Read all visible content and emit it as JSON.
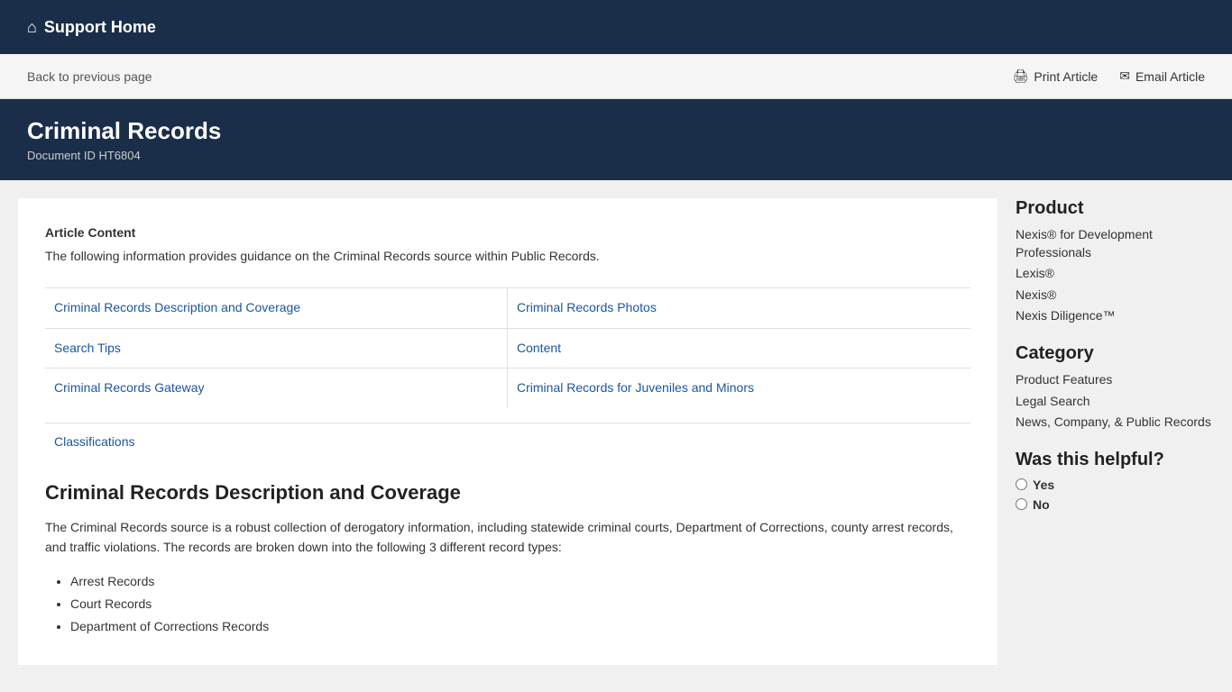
{
  "topNav": {
    "homeIcon": "⌂",
    "homeLabel": "Support Home",
    "homeUrl": "#"
  },
  "secondaryNav": {
    "backLabel": "Back to previous page",
    "printLabel": "Print Article",
    "emailLabel": "Email Article",
    "printIcon": "🖨",
    "emailIcon": "✉"
  },
  "articleHeader": {
    "title": "Criminal Records",
    "docId": "Document ID HT6804"
  },
  "articleContent": {
    "contentLabel": "Article Content",
    "intro": "The following information provides guidance on the Criminal Records source within Public Records.",
    "tocLinks": [
      {
        "text": "Criminal Records Description and Coverage",
        "href": "#desc"
      },
      {
        "text": "Criminal Records Photos",
        "href": "#photos"
      },
      {
        "text": "Search Tips",
        "href": "#search-tips"
      },
      {
        "text": "Content",
        "href": "#content"
      },
      {
        "text": "Criminal Records Gateway",
        "href": "#gateway"
      },
      {
        "text": "Criminal Records for Juveniles and Minors",
        "href": "#juveniles"
      }
    ],
    "classificationsLink": "Classifications",
    "sectionHeading": "Criminal Records Description and Coverage",
    "sectionBody": "The Criminal Records source is a robust collection of derogatory information, including statewide criminal courts, Department of Corrections, county arrest records, and traffic violations. The records are broken down into the following 3 different record types:",
    "listItems": [
      "Arrest Records",
      "Court Records",
      "Department of Corrections Records"
    ]
  },
  "sidebar": {
    "productTitle": "Product",
    "productItems": [
      "Nexis® for Development Professionals",
      "Lexis®",
      "Nexis®",
      "Nexis Diligence™"
    ],
    "categoryTitle": "Category",
    "categoryItems": [
      "Product Features",
      "Legal Search",
      "News, Company, & Public Records"
    ],
    "helpfulTitle": "Was this helpful?",
    "helpfulOptions": [
      {
        "label": "Yes",
        "value": "yes"
      },
      {
        "label": "No",
        "value": "no"
      }
    ]
  }
}
